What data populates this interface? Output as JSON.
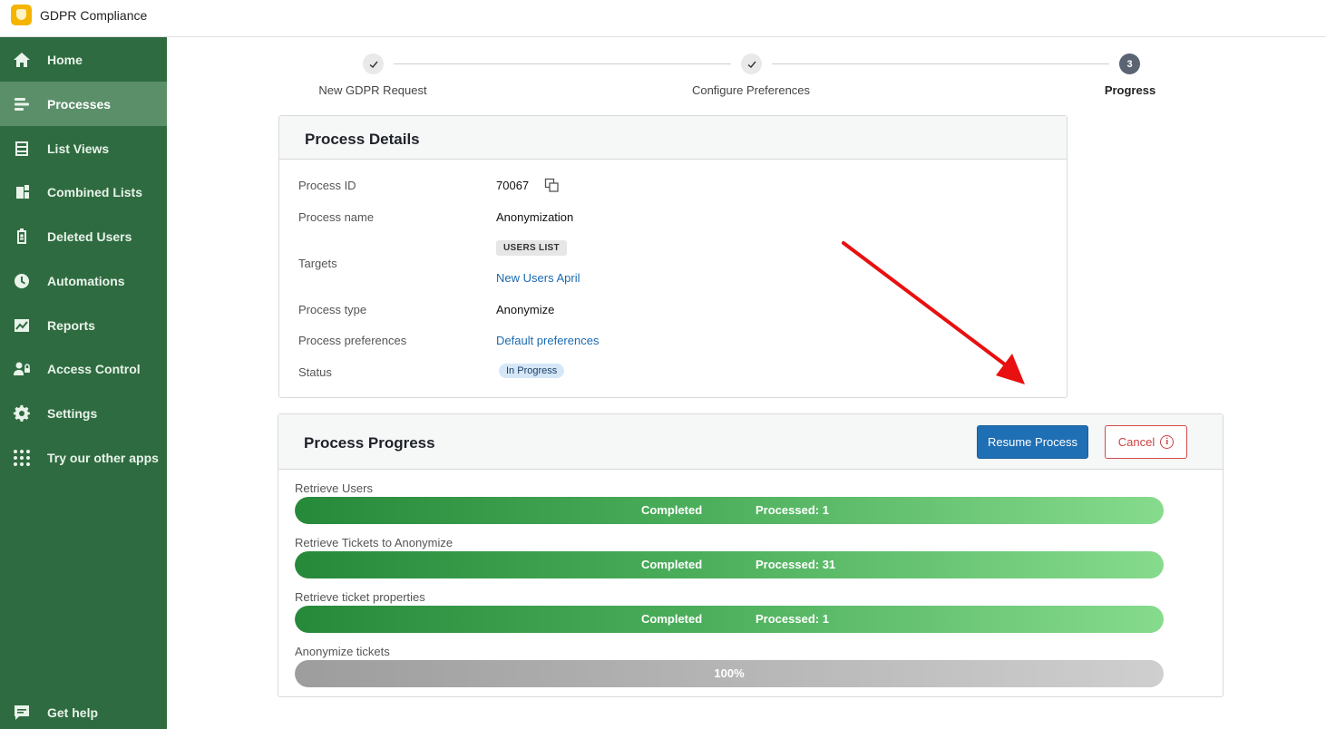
{
  "app": {
    "title": "GDPR Compliance"
  },
  "sidebar": {
    "items": [
      {
        "label": "Home",
        "icon": "home-icon"
      },
      {
        "label": "Processes",
        "icon": "processes-icon",
        "active": true
      },
      {
        "label": "List Views",
        "icon": "list-views-icon"
      },
      {
        "label": "Combined Lists",
        "icon": "combined-lists-icon"
      },
      {
        "label": "Deleted Users",
        "icon": "deleted-users-icon"
      },
      {
        "label": "Automations",
        "icon": "clock-icon"
      },
      {
        "label": "Reports",
        "icon": "chart-icon"
      },
      {
        "label": "Access Control",
        "icon": "user-lock-icon"
      },
      {
        "label": "Settings",
        "icon": "gear-icon"
      },
      {
        "label": "Try our other apps",
        "icon": "grid-icon"
      }
    ],
    "help": {
      "label": "Get help",
      "icon": "chat-icon"
    }
  },
  "stepper": {
    "steps": [
      {
        "label": "New GDPR Request",
        "state": "done"
      },
      {
        "label": "Configure Preferences",
        "state": "done"
      },
      {
        "label": "Progress",
        "number": "3",
        "state": "current"
      }
    ]
  },
  "details": {
    "title": "Process Details",
    "process_id_label": "Process ID",
    "process_id": "70067",
    "process_name_label": "Process name",
    "process_name": "Anonymization",
    "targets_label": "Targets",
    "targets_tag": "USERS LIST",
    "targets_link": "New Users April",
    "process_type_label": "Process type",
    "process_type": "Anonymize",
    "preferences_label": "Process preferences",
    "preferences_link": "Default preferences",
    "status_label": "Status",
    "status": "In Progress"
  },
  "progress": {
    "title": "Process Progress",
    "resume_label": "Resume Process",
    "cancel_label": "Cancel",
    "tasks": [
      {
        "label": "Retrieve Users",
        "status": "Completed",
        "processed": "Processed: 1",
        "percent": 100,
        "color": "green"
      },
      {
        "label": "Retrieve Tickets to Anonymize",
        "status": "Completed",
        "processed": "Processed: 31",
        "percent": 100,
        "color": "green"
      },
      {
        "label": "Retrieve ticket properties",
        "status": "Completed",
        "processed": "Processed: 1",
        "percent": 100,
        "color": "green"
      },
      {
        "label": "Anonymize tickets",
        "percent_text": "100%",
        "percent": 100,
        "color": "gray"
      }
    ]
  },
  "colors": {
    "sidebar": "#2f6b40",
    "sidebar_active": "#5b8f6a",
    "primary": "#1f6fb5",
    "danger": "#d24a4a",
    "annotation_arrow": "#e81010"
  }
}
